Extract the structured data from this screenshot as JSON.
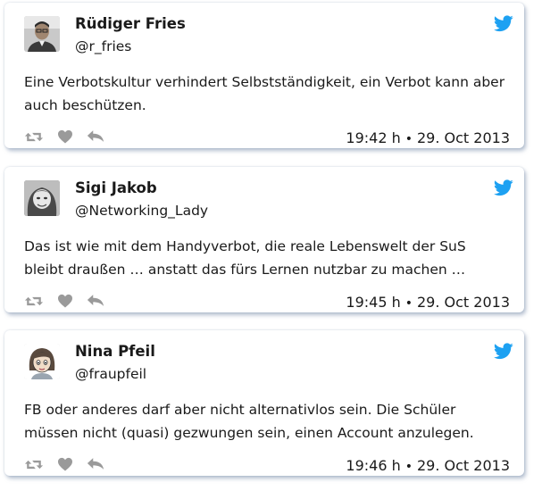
{
  "tweets": [
    {
      "name": "Rüdiger Fries",
      "handle": "@r_fries",
      "text": "Eine Verbotskultur verhindert Selbstständigkeit, ein Verbot kann aber auch beschützen.",
      "time": "19:42 h",
      "separator": "•",
      "date": "29. Oct 2013"
    },
    {
      "name": "Sigi Jakob",
      "handle": "@Networking_Lady",
      "text": "Das ist wie mit dem Handyverbot, die reale Lebenswelt der SuS bleibt draußen … anstatt das fürs Lernen nutzbar zu machen …",
      "time": "19:45 h",
      "separator": "•",
      "date": "29. Oct 2013"
    },
    {
      "name": "Nina Pfeil",
      "handle": "@fraupfeil",
      "text": "FB oder anderes darf aber nicht alternativlos sein. Die Schüler müssen nicht (quasi) gezwungen sein, einen Account anzulegen.",
      "time": "19:46 h",
      "separator": "•",
      "date": "29. Oct 2013"
    }
  ],
  "icons": {
    "brand": "twitter-bird-icon",
    "actions": [
      "retweet-icon",
      "like-heart-icon",
      "reply-arrow-icon"
    ]
  },
  "colors": {
    "twitter_blue": "#1da1f2",
    "action_gray": "#9a9a9a",
    "card_shadow": "#788caa"
  }
}
